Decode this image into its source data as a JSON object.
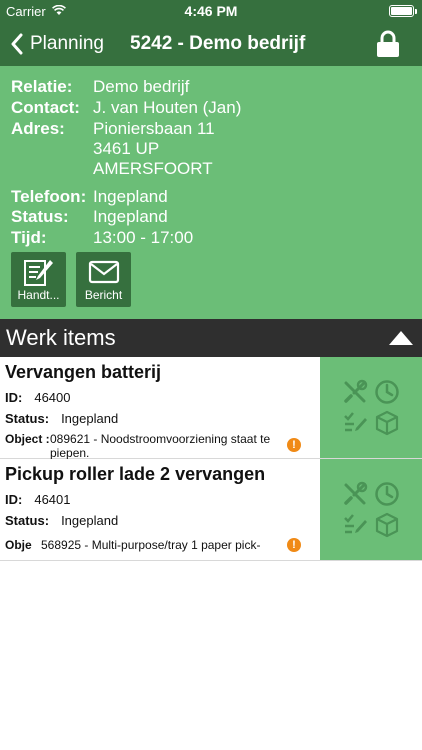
{
  "status_bar": {
    "carrier": "Carrier",
    "time": "4:46 PM"
  },
  "nav": {
    "back_label": "Planning",
    "title": "5242 - Demo bedrijf"
  },
  "details": {
    "relatie": {
      "label": "Relatie:",
      "value": "Demo bedrijf"
    },
    "contact": {
      "label": "Contact:",
      "value": "J. van Houten (Jan)"
    },
    "adres": {
      "label": "Adres:",
      "lines": [
        "Pioniersbaan 11",
        "3461 UP",
        "AMERSFOORT"
      ]
    },
    "telefoon": {
      "label": "Telefoon:",
      "value": "Ingepland"
    },
    "status": {
      "label": "Status:",
      "value": "Ingepland"
    },
    "tijd": {
      "label": "Tijd:",
      "value": "13:00 - 17:00"
    }
  },
  "buttons": {
    "signature_label": "Handt...",
    "message_label": "Bericht"
  },
  "section": {
    "title": "Werk items"
  },
  "work_items": [
    {
      "title": "Vervangen batterij",
      "id_label": "ID:",
      "id": "46400",
      "status_label": "Status:",
      "status": "Ingepland",
      "object_label": "Object :",
      "object": "089621 - Noodstroomvoorziening staat te piepen.",
      "warning": "!"
    },
    {
      "title": "Pickup roller lade 2 vervangen",
      "id_label": "ID:",
      "id": "46401",
      "status_label": "Status:",
      "status": "Ingepland",
      "object_label": "Obje",
      "object": "568925 - Multi-purpose/tray 1 paper pick-",
      "warning": "!"
    }
  ],
  "colors": {
    "header_dark_green": "#36703e",
    "panel_green": "#6bbe77",
    "section_dark": "#2f2f2f",
    "warning_orange": "#f08a16",
    "action_icon": "#4a9456"
  },
  "icons": {
    "back": "chevron-left-icon",
    "lock": "lock-icon",
    "signature": "signature-icon",
    "message": "envelope-icon",
    "toggle": "triangle-up-icon",
    "tools": "tools-icon",
    "clock": "clock-icon",
    "checklist": "checklist-icon",
    "package": "package-icon",
    "warning": "warning-icon"
  }
}
